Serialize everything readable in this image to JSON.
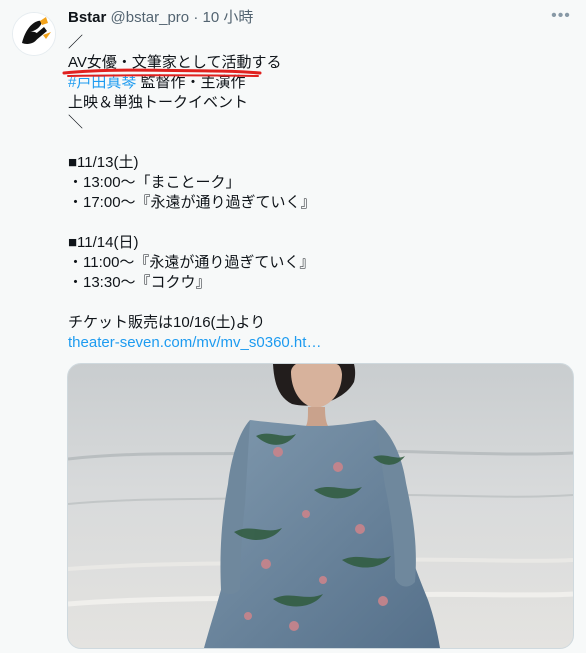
{
  "tweet": {
    "author_name": "Bstar",
    "handle": "@bstar_pro",
    "separator": "·",
    "time": "10 小時",
    "more_icon": "more-horizontal-icon",
    "lines": {
      "l1": "／",
      "l2": "AV女優・文筆家として活動する",
      "l3_link": "#戸田真琴",
      "l3_rest": " 監督作・主演作",
      "l4": "上映＆単独トークイベント",
      "l5": "＼",
      "l7": "■11/13(土)",
      "l8": "・13:00～「まことーク」",
      "l9": "・17:00～『永遠が通り過ぎていく』",
      "l11": "■11/14(日)",
      "l12": "・11:00～『永遠が通り過ぎていく』",
      "l13": "・13:30～『コクウ』",
      "l15": "チケット販売は10/16(土)より",
      "l16_link": "theater-seven.com/mv/mv_s0360.ht…"
    },
    "colors": {
      "link": "#1d9bf0",
      "underline_annotation": "#e0211f"
    }
  }
}
